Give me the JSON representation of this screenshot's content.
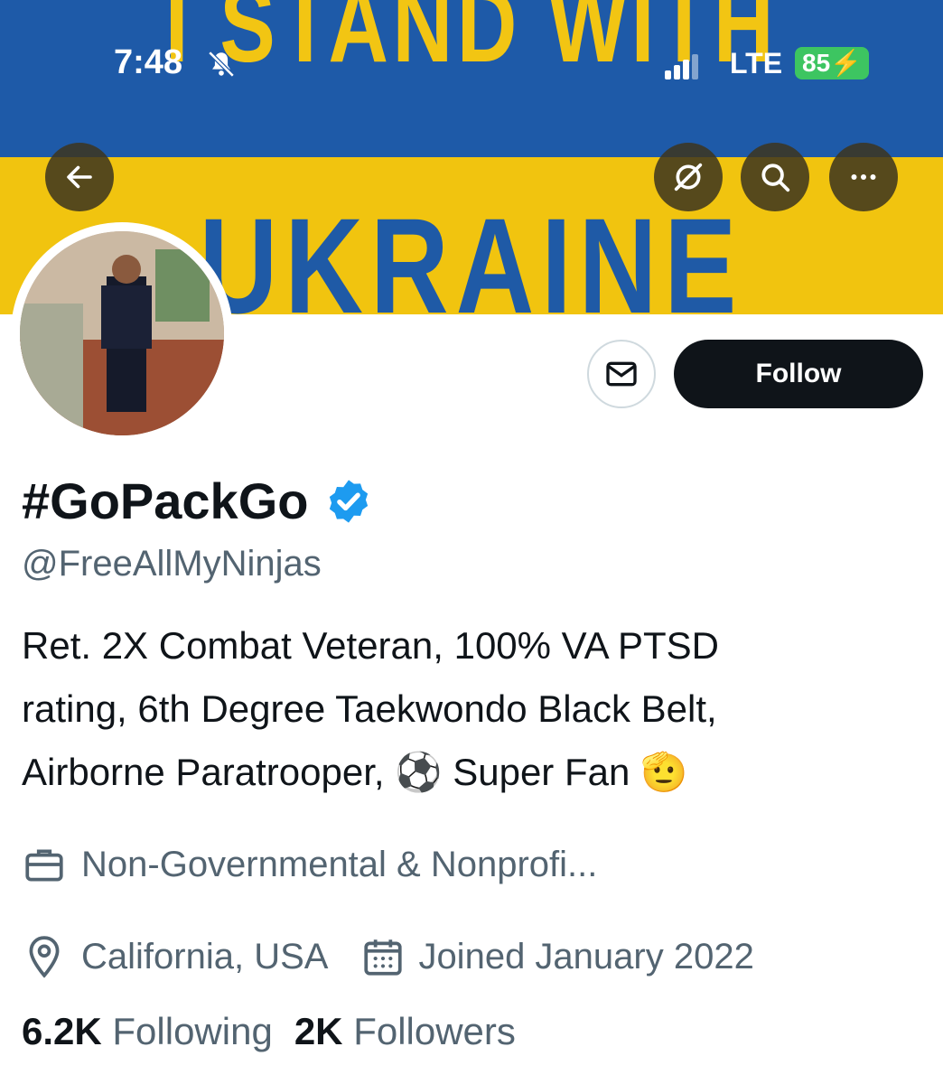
{
  "banner": {
    "top_text": "I STAND WITH",
    "bottom_text": "UKRAINE",
    "colors": {
      "blue": "#1e5aa8",
      "yellow": "#f1c40f"
    }
  },
  "status_bar": {
    "time": "7:48",
    "silent_icon": "bell-slash-icon",
    "network": "LTE",
    "battery": "85"
  },
  "top_actions": {
    "back_icon": "arrow-left-icon",
    "grok_icon": "grok-slash-icon",
    "search_icon": "search-icon",
    "more_icon": "more-horizontal-icon"
  },
  "profile": {
    "display_name": "#GoPackGo",
    "verified": true,
    "handle": "@FreeAllMyNinjas",
    "follow_label": "Follow",
    "bio_line1": "Ret. 2X Combat Veteran, 100% VA PTSD",
    "bio_line2": "rating, 6th Degree Taekwondo Black Belt,",
    "bio_line3_a": "Airborne Paratrooper,",
    "bio_emoji_1": "⚽",
    "bio_line3_b": "Super Fan",
    "bio_emoji_2": "🫡",
    "category": "Non-Governmental & Nonprofi...",
    "location": "California, USA",
    "joined": "Joined January 2022",
    "following_count": "6.2K",
    "following_label": "Following",
    "followers_count": "2K",
    "followers_label": "Followers"
  },
  "colors": {
    "accent_verified": "#1d9bf0",
    "text_primary": "#0f1419",
    "text_secondary": "#536471"
  }
}
